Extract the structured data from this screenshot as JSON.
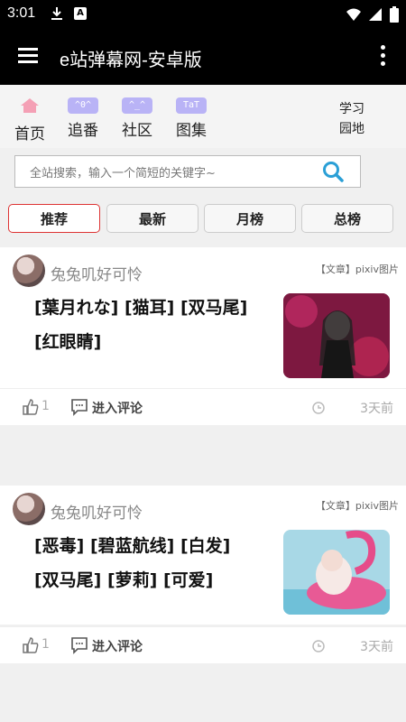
{
  "status": {
    "time": "3:01",
    "a_icon": "A"
  },
  "appbar": {
    "title": "e站弹幕网-安卓版"
  },
  "nav": [
    {
      "label": "首页",
      "icon": "home-icon",
      "text": ""
    },
    {
      "label": "追番",
      "icon": "kaomoji-icon",
      "text": "^0^"
    },
    {
      "label": "社区",
      "icon": "kaomoji-icon",
      "text": "^_^"
    },
    {
      "label": "图集",
      "icon": "kaomoji-icon",
      "text": "TaT"
    }
  ],
  "study": {
    "line1": "学习",
    "line2": "园地"
  },
  "search": {
    "placeholder": "全站搜索，输入一个简短的关键字~"
  },
  "tabs": [
    "推荐",
    "最新",
    "月榜",
    "总榜"
  ],
  "posts": [
    {
      "author": "兔兔叽好可怜",
      "meta": "【文章】pixiv图片",
      "tags_line1": "[葉月れな] [猫耳] [双马尾]",
      "tags_line2": "[红眼睛]",
      "likes": "1",
      "comment_label": "进入评论",
      "time": "3天前"
    },
    {
      "author": "兔兔叽好可怜",
      "meta": "【文章】pixiv图片",
      "tags_line1": "[恶毒] [碧蓝航线] [白发]",
      "tags_line2": "[双马尾] [萝莉] [可爱]",
      "likes": "1",
      "comment_label": "进入评论",
      "time": "3天前"
    }
  ],
  "colors": {
    "accent": "#2a9fd6",
    "active_tab_border": "#dd3333",
    "nav_icon_bg": "#b9b3f6"
  }
}
